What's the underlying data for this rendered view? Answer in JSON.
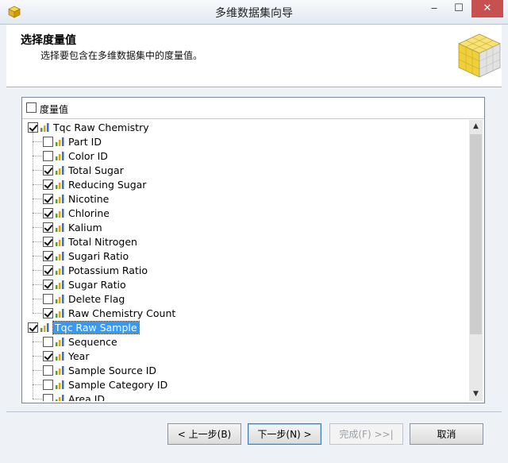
{
  "window": {
    "title": "多维数据集向导",
    "minimize": "‒",
    "maximize": "☐",
    "close": "✕"
  },
  "header": {
    "title": "选择度量值",
    "subtitle": "选择要包含在多维数据集中的度量值。"
  },
  "tree": {
    "column_header": "度量值",
    "column_header_checked": false,
    "groups": [
      {
        "label": "Tqc Raw Chemistry",
        "checked": true,
        "selected": false,
        "items": [
          {
            "label": "Part ID",
            "checked": false
          },
          {
            "label": "Color ID",
            "checked": false
          },
          {
            "label": "Total Sugar",
            "checked": true
          },
          {
            "label": "Reducing Sugar",
            "checked": true
          },
          {
            "label": "Nicotine",
            "checked": true
          },
          {
            "label": "Chlorine",
            "checked": true
          },
          {
            "label": "Kalium",
            "checked": true
          },
          {
            "label": "Total Nitrogen",
            "checked": true
          },
          {
            "label": "Sugari Ratio",
            "checked": true
          },
          {
            "label": "Potassium Ratio",
            "checked": true
          },
          {
            "label": "Sugar Ratio",
            "checked": true
          },
          {
            "label": "Delete Flag",
            "checked": false
          },
          {
            "label": "Raw Chemistry Count",
            "checked": true
          }
        ]
      },
      {
        "label": "Tqc Raw Sample",
        "checked": true,
        "selected": true,
        "items": [
          {
            "label": "Sequence",
            "checked": false
          },
          {
            "label": "Year",
            "checked": true
          },
          {
            "label": "Sample Source ID",
            "checked": false
          },
          {
            "label": "Sample Category ID",
            "checked": false
          },
          {
            "label": "Area ID",
            "checked": false
          }
        ]
      }
    ]
  },
  "scrollbar": {
    "up_arrow": "▲",
    "down_arrow": "▼"
  },
  "buttons": {
    "back": "< 上一步(B)",
    "next": "下一步(N) >",
    "finish": "完成(F) >>|",
    "cancel": "取消"
  }
}
